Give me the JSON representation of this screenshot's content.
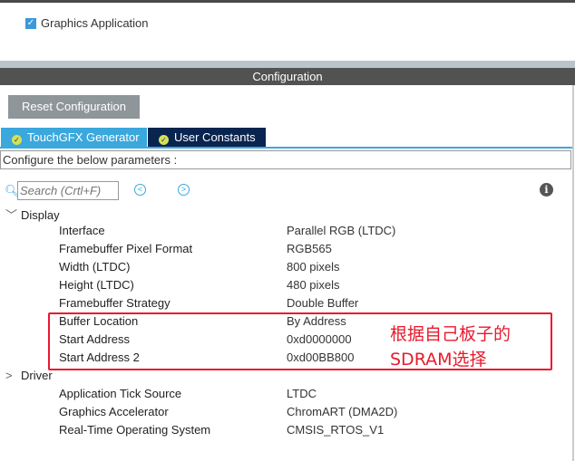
{
  "app": {
    "checkbox_label": "Graphics Application",
    "checked": true
  },
  "config": {
    "title": "Configuration",
    "reset_label": "Reset Configuration",
    "tabs": [
      {
        "label": "TouchGFX Generator"
      },
      {
        "label": "User Constants"
      }
    ],
    "description": "Configure the below parameters :",
    "search_placeholder": "Search (Crtl+F)",
    "groups": [
      {
        "name": "Display",
        "params": [
          {
            "label": "Interface",
            "value": "Parallel RGB (LTDC)"
          },
          {
            "label": "Framebuffer Pixel Format",
            "value": "RGB565"
          },
          {
            "label": "Width (LTDC)",
            "value": "800 pixels"
          },
          {
            "label": "Height (LTDC)",
            "value": "480 pixels"
          },
          {
            "label": "Framebuffer Strategy",
            "value": "Double Buffer"
          },
          {
            "label": "Buffer Location",
            "value": "By Address"
          },
          {
            "label": "Start Address",
            "value": "0xd0000000"
          },
          {
            "label": "Start Address 2",
            "value": "0xd00BB800"
          }
        ]
      },
      {
        "name": "Driver",
        "params": [
          {
            "label": "Application Tick Source",
            "value": "LTDC"
          },
          {
            "label": "Graphics Accelerator",
            "value": "ChromART (DMA2D)"
          },
          {
            "label": "Real-Time Operating System",
            "value": "CMSIS_RTOS_V1"
          }
        ]
      }
    ]
  },
  "annotation": {
    "line1": "根据自己板子的",
    "line2": "SDRAM选择",
    "color": "#e8192c"
  }
}
